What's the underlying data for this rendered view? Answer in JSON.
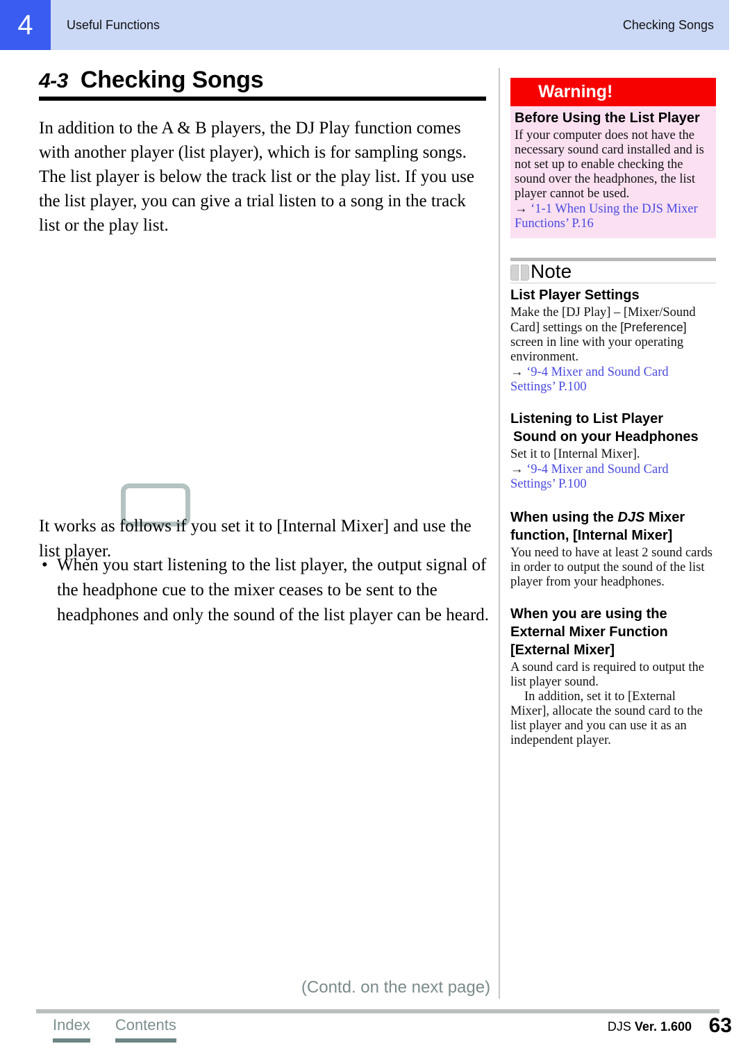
{
  "header": {
    "chapter_number": "4",
    "chapter_title": "Useful Functions",
    "section_title": "Checking Songs",
    "badge_color": "#3a5cf0",
    "band_color": "#cbd9f7"
  },
  "section": {
    "number": "4-3",
    "title": "Checking Songs",
    "intro_paragraph": "In addition to the A & B players, the DJ Play function comes with another player (list player), which is for sampling songs. The list player is below the track list or the play list. If you use the list player, you can give a trial listen to a song in the track list or the play list.",
    "works_paragraph": "It works as follows if you set it to [Internal Mixer] and use the list player.",
    "bullets": [
      {
        "marker": "•",
        "text": "When you start listening to the list player, the output signal of the headphone cue to the mixer ceases to be sent to the headphones and only the sound of the list player can be heard."
      }
    ]
  },
  "warning": {
    "banner_label": "Warning!",
    "banner_color": "#f70000",
    "background_color": "#fbe0f2",
    "heading": "Before Using the List Player",
    "text": "If your computer does not have the necessary sound card installed and is not set up to enable checking the sound over the headphones, the list player cannot be used.",
    "link_arrow": "→",
    "link_text": "‘1-1  When Using the DJS Mixer Functions’ P.16",
    "link_color": "#4a4ae0"
  },
  "note": {
    "label": "Note",
    "icon": "open-book-icon",
    "sections": [
      {
        "heading": "List Player Settings",
        "text_before_ui": "Make the [DJ Play] – [Mixer/Sound Card] settings on the ",
        "ui_token": "[Preference]",
        "text_after_ui": " screen in line with your operating environment.",
        "link_arrow": "→",
        "link_text": "‘9-4  Mixer and Sound Card Settings’ P.100"
      },
      {
        "heading_line1": "Listening to List Player",
        "heading_line2": "Sound on your Headphones",
        "text": "Set it to [Internal Mixer].",
        "link_arrow": "→",
        "link_text": "‘9-4  Mixer and Sound Card Settings’ P.100"
      },
      {
        "heading_prefix": "When using the ",
        "heading_italic": "DJS",
        "heading_suffix": " Mixer function, [Internal Mixer]",
        "text": "You need to have at least 2 sound cards in order to output the sound of the list player from your headphones."
      },
      {
        "heading": "When you are using the External Mixer Function [External Mixer]",
        "text": "A sound card is required to output the list player sound.",
        "text2": "In addition, set it to [External Mixer], allocate the sound card to the list player and you can use it as an independent player."
      }
    ]
  },
  "footer": {
    "contd_note": "(Contd. on the next page)",
    "links": [
      {
        "label": "Index"
      },
      {
        "label": "Contents"
      }
    ],
    "version_app": "DJS ",
    "version_text": "Ver. 1.600",
    "page_number": "63",
    "link_color": "#7e8f8f",
    "rule_color": "#b9bfbf"
  }
}
